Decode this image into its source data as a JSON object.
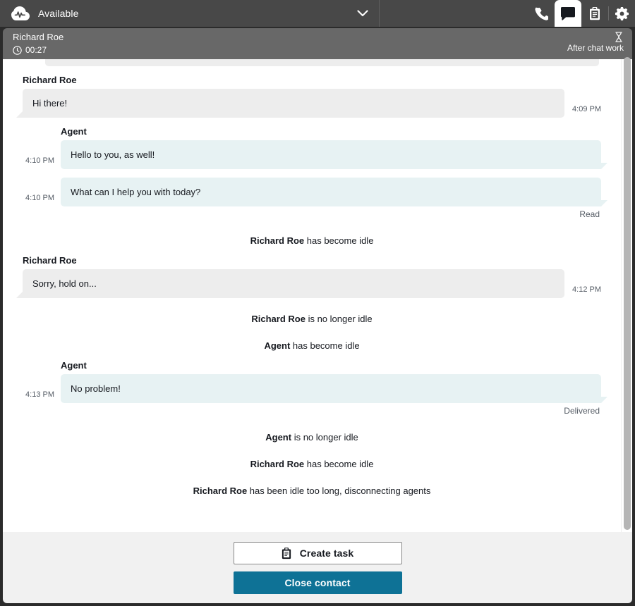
{
  "topbar": {
    "logo_icon": "connect-cloud-logo-icon",
    "status_label": "Available",
    "status_chevron_icon": "chevron-down-icon",
    "tabs": [
      {
        "name": "phone",
        "icon": "phone-icon",
        "selected": false
      },
      {
        "name": "chat",
        "icon": "chat-bubble-icon",
        "selected": true
      },
      {
        "name": "tasks",
        "icon": "clipboard-icon",
        "selected": false
      },
      {
        "name": "settings",
        "icon": "gear-icon",
        "selected": false
      }
    ]
  },
  "contact_header": {
    "name": "Richard Roe",
    "timer_icon": "clock-icon",
    "timer": "00:27",
    "state_icon": "hourglass-icon",
    "state_label": "After chat work"
  },
  "transcript": {
    "items": [
      {
        "kind": "message",
        "side": "customer",
        "sender": "Richard Roe",
        "text": "Hi there!",
        "time": "4:09 PM",
        "receipt": ""
      },
      {
        "kind": "message",
        "side": "agent",
        "sender": "Agent",
        "text": "Hello to you, as well!",
        "time": "4:10 PM",
        "receipt": ""
      },
      {
        "kind": "message",
        "side": "agent",
        "sender": "",
        "text": "What can I help you with today?",
        "time": "4:10 PM",
        "receipt": "Read"
      },
      {
        "kind": "system",
        "actor": "Richard Roe",
        "text": "has become idle"
      },
      {
        "kind": "message",
        "side": "customer",
        "sender": "Richard Roe",
        "text": "Sorry, hold on...",
        "time": "4:12 PM",
        "receipt": ""
      },
      {
        "kind": "system",
        "actor": "Richard Roe",
        "text": "is no longer idle"
      },
      {
        "kind": "system",
        "actor": "Agent",
        "text": "has become idle"
      },
      {
        "kind": "message",
        "side": "agent",
        "sender": "Agent",
        "text": "No problem!",
        "time": "4:13 PM",
        "receipt": "Delivered"
      },
      {
        "kind": "system",
        "actor": "Agent",
        "text": "is no longer idle"
      },
      {
        "kind": "system",
        "actor": "Richard Roe",
        "text": "has become idle"
      },
      {
        "kind": "system",
        "actor": "Richard Roe",
        "text": "has been idle too long, disconnecting agents"
      }
    ]
  },
  "footer": {
    "create_task_icon": "clipboard-icon",
    "create_task_label": "Create task",
    "close_contact_label": "Close contact"
  },
  "colors": {
    "topbar_bg": "#484848",
    "contact_header_bg": "#686868",
    "customer_bubble": "#ededed",
    "agent_bubble": "#e7f2f3",
    "primary_button": "#0e7296",
    "footer_bg": "#f1f1f1"
  }
}
